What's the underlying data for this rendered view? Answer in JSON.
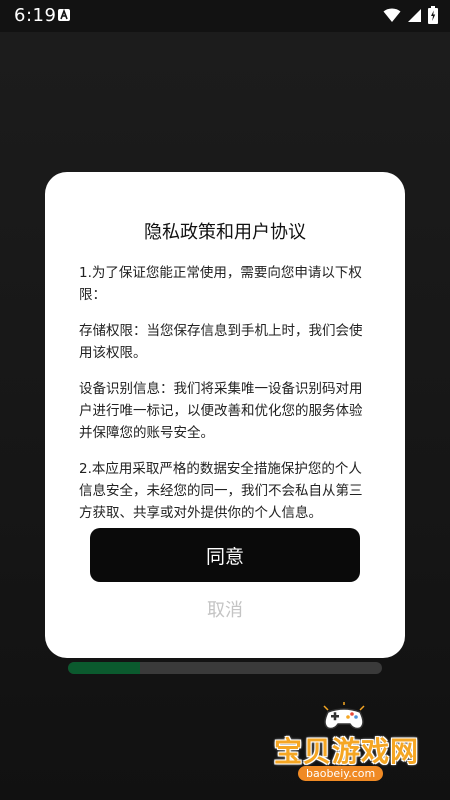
{
  "status_bar": {
    "time": "6:19",
    "indicator_icon": "a-notification-icon",
    "icons": [
      "wifi-icon",
      "cell-signal-icon",
      "battery-icon"
    ]
  },
  "dialog": {
    "title": "隐私政策和用户协议",
    "paragraphs": [
      "1.为了保证您能正常使用，需要向您申请以下权限：",
      "存储权限：当您保存信息到手机上时，我们会使用该权限。",
      "设备识别信息：我们将采集唯一设备识别码对用户进行唯一标记，以便改善和优化您的服务体验并保障您的账号安全。",
      "2.本应用采取严格的数据安全措施保护您的个人信息安全，未经您的同一，我们不会私自从第三方获取、共享或对外提供你的个人信息。"
    ],
    "agree_label": "同意",
    "cancel_label": "取消"
  },
  "progress": {
    "fraction": 0.23
  },
  "watermark": {
    "text": "宝贝游戏网",
    "url": "baobeiy.com"
  },
  "colors": {
    "background": "#171717",
    "dialog": "#ffffff",
    "agree_button": "#0a0a0a",
    "cancel_text": "#c4c4c4",
    "progress_fill": "#0b5a2e",
    "progress_track": "#3a3a3a",
    "watermark_orange": "#f5a623"
  }
}
